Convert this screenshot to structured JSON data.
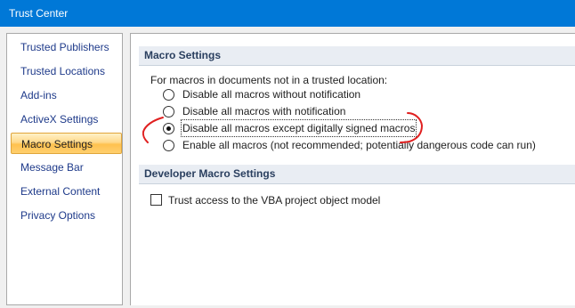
{
  "window": {
    "title": "Trust Center"
  },
  "sidebar": {
    "items": [
      {
        "label": "Trusted Publishers"
      },
      {
        "label": "Trusted Locations"
      },
      {
        "label": "Add-ins"
      },
      {
        "label": "ActiveX Settings"
      },
      {
        "label": "Macro Settings",
        "selected": true
      },
      {
        "label": "Message Bar"
      },
      {
        "label": "External Content"
      },
      {
        "label": "Privacy Options"
      }
    ]
  },
  "macro_settings": {
    "header": "Macro Settings",
    "intro": "For macros in documents not in a trusted location:",
    "options": [
      {
        "label": "Disable all macros without notification",
        "checked": false
      },
      {
        "label": "Disable all macros with notification",
        "checked": false
      },
      {
        "label": "Disable all macros except digitally signed macros",
        "checked": true
      },
      {
        "label": "Enable all macros (not recommended; potentially dangerous code can run)",
        "checked": false
      }
    ]
  },
  "developer_settings": {
    "header": "Developer Macro Settings",
    "trust_vba_label": "Trust access to the VBA project object model",
    "trust_vba_checked": false
  },
  "colors": {
    "titlebar": "#0078d7",
    "annotation": "#e02020",
    "selected_item": "#ffc14f"
  }
}
